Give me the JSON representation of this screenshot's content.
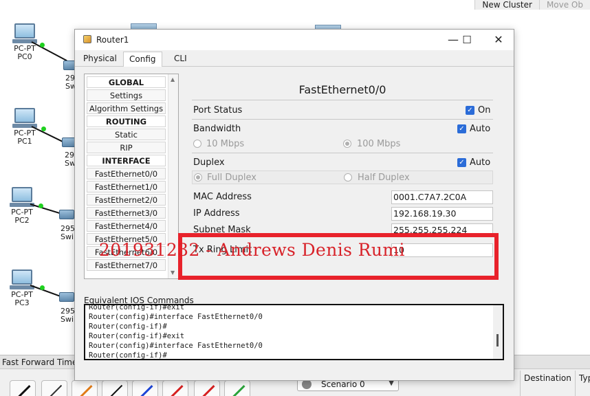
{
  "topbar": {
    "new_cluster": "New Cluster",
    "move_object": "Move Ob"
  },
  "devices": {
    "pcs": [
      {
        "type": "PC-PT",
        "name": "PC0"
      },
      {
        "type": "PC-PT",
        "name": "PC1"
      },
      {
        "type": "PC-PT",
        "name": "PC2"
      },
      {
        "type": "PC-PT",
        "name": "PC3"
      }
    ],
    "switch_labels": [
      {
        "line1": "29",
        "line2": "Sw"
      },
      {
        "line1": "29",
        "line2": "Sw"
      },
      {
        "line1": "295",
        "line2": "Swi"
      },
      {
        "line1": "295",
        "line2": "Swi"
      }
    ]
  },
  "ff_bar": {
    "label": "Fast Forward Time"
  },
  "bottom": {
    "scenario": "Scenario 0",
    "col_destination": "Destination",
    "col_type": "Typ"
  },
  "window": {
    "title": "Router1",
    "tabs": [
      "Physical",
      "Config",
      "CLI"
    ],
    "active_tab": "Config"
  },
  "nav": {
    "items": [
      {
        "label": "GLOBAL",
        "header": true
      },
      {
        "label": "Settings"
      },
      {
        "label": "Algorithm Settings"
      },
      {
        "label": "ROUTING",
        "header": true
      },
      {
        "label": "Static"
      },
      {
        "label": "RIP"
      },
      {
        "label": "INTERFACE",
        "header": true
      },
      {
        "label": "FastEthernet0/0"
      },
      {
        "label": "FastEthernet1/0"
      },
      {
        "label": "FastEthernet2/0"
      },
      {
        "label": "FastEthernet3/0"
      },
      {
        "label": "FastEthernet4/0"
      },
      {
        "label": "FastEthernet5/0"
      },
      {
        "label": "FastEthernet6/0"
      },
      {
        "label": "FastEthernet7/0"
      }
    ]
  },
  "interface": {
    "title": "FastEthernet0/0",
    "port_status_label": "Port Status",
    "port_status_value": "On",
    "port_status_checked": true,
    "bandwidth_label": "Bandwidth",
    "bandwidth_auto": "Auto",
    "bandwidth_10": "10 Mbps",
    "bandwidth_100": "100 Mbps",
    "duplex_label": "Duplex",
    "duplex_auto": "Auto",
    "duplex_full": "Full Duplex",
    "duplex_half": "Half Duplex",
    "mac_label": "MAC Address",
    "mac_value": "0001.C7A7.2C0A",
    "ip_label": "IP Address",
    "ip_value": "192.168.19.30",
    "mask_label": "Subnet Mask",
    "mask_value": "255.255.255.224",
    "tx_label": "Tx Ring Limit",
    "tx_value": "10"
  },
  "watermark": "201931232 - Andrews Denis Rumi",
  "ios": {
    "label": "Equivalent IOS Commands",
    "lines": [
      "Router(config-if)#exit",
      "Router(config)#interface FastEthernet0/0",
      "Router(config-if)#",
      "Router(config-if)#exit",
      "Router(config)#interface FastEthernet0/0",
      "Router(config-if)#"
    ]
  },
  "colors": {
    "accent": "#2b6cd8",
    "highlight_red": "#e8222b",
    "link_green": "#1fd11f"
  }
}
